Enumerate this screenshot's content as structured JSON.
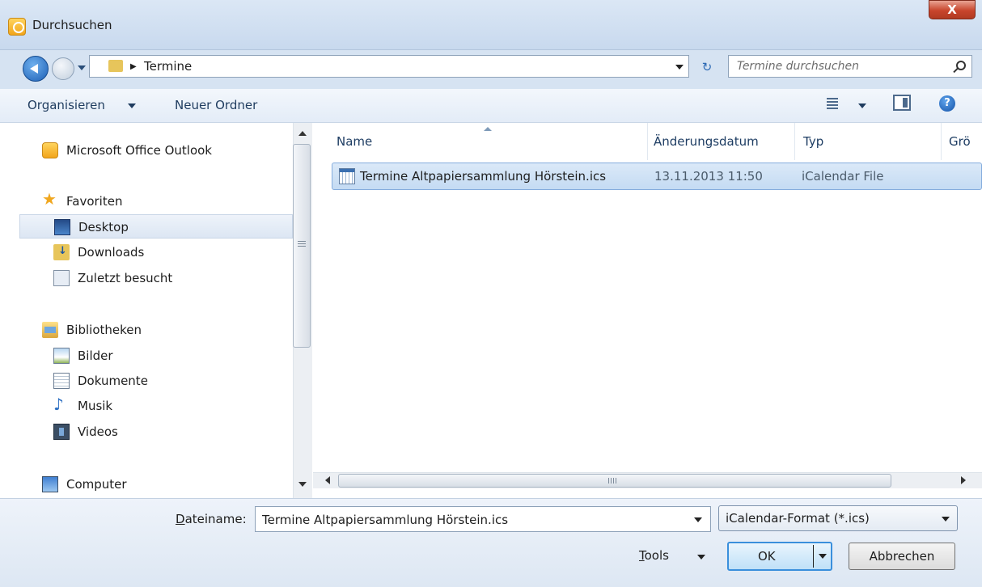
{
  "window": {
    "title": "Durchsuchen",
    "close_glyph": "X"
  },
  "address": {
    "path": "Termine",
    "search_placeholder": "Termine durchsuchen"
  },
  "toolbar": {
    "organize_label": "Organisieren",
    "new_folder_label": "Neuer Ordner"
  },
  "nav": {
    "items": [
      {
        "label": "Microsoft Office Outlook",
        "icon": "outlook-icon"
      },
      {
        "label": "Favoriten",
        "icon": "star-icon"
      },
      {
        "label": "Desktop",
        "icon": "desktop-icon",
        "selected": true
      },
      {
        "label": "Downloads",
        "icon": "downloads-folder-icon"
      },
      {
        "label": "Zuletzt besucht",
        "icon": "recent-places-icon"
      },
      {
        "label": "Bibliotheken",
        "icon": "libraries-icon"
      },
      {
        "label": "Bilder",
        "icon": "pictures-icon"
      },
      {
        "label": "Dokumente",
        "icon": "documents-icon"
      },
      {
        "label": "Musik",
        "icon": "music-icon"
      },
      {
        "label": "Videos",
        "icon": "videos-icon"
      },
      {
        "label": "Computer",
        "icon": "computer-icon"
      }
    ]
  },
  "columns": {
    "name": "Name",
    "date": "Änderungsdatum",
    "type": "Typ",
    "size": "Grö"
  },
  "files": [
    {
      "name": "Termine Altpapiersammlung Hörstein.ics",
      "date": "13.11.2013 11:50",
      "type": "iCalendar File",
      "icon": "icalendar-file-icon"
    }
  ],
  "bottom": {
    "filename_label_underlined": "D",
    "filename_label_rest": "ateiname:",
    "filename_value": "Termine Altpapiersammlung Hörstein.ics",
    "filter_value": "iCalendar-Format (*.ics)",
    "tools_underlined": "T",
    "tools_rest": "ools",
    "ok_label": "OK",
    "cancel_label": "Abbrechen"
  },
  "colors": {
    "titlebar": "#dbe7f5",
    "selection": "#c4dbf3",
    "close_button": "#c8452c"
  }
}
